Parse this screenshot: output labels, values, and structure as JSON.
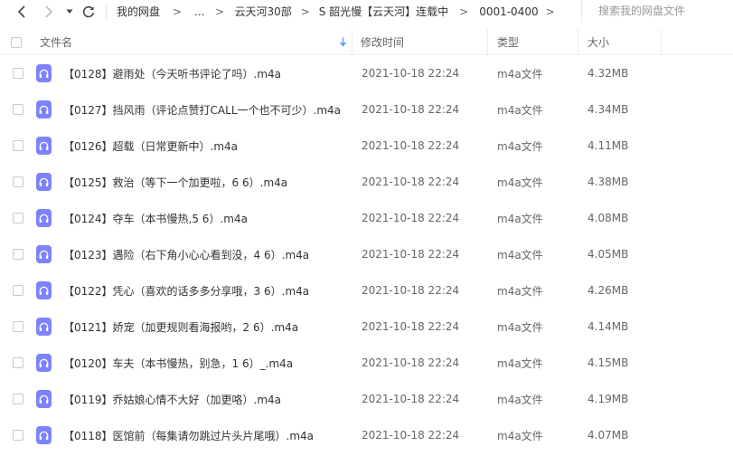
{
  "toolbar": {
    "breadcrumb": [
      "我的网盘",
      "...",
      "云天河30部",
      "S 韶光慢【云天河】连载中",
      "0001-0400"
    ],
    "breadcrumb_separator": ">",
    "search_placeholder": "搜索我的网盘文件"
  },
  "columns": {
    "name": "文件名",
    "modified": "修改时间",
    "type": "类型",
    "size": "大小",
    "sort_icon": "arrow-down-icon"
  },
  "colors": {
    "audio_icon": "#7c83fd",
    "sort_arrow": "#4a8cf7"
  },
  "files": [
    {
      "name": "【0128】避雨处（今天听书评论了吗）.m4a",
      "modified": "2021-10-18 22:24",
      "type": "m4a文件",
      "size": "4.32MB",
      "icon": "audio-file-icon"
    },
    {
      "name": "【0127】挡风雨（评论点赞打CALL一个也不可少）.m4a",
      "modified": "2021-10-18 22:24",
      "type": "m4a文件",
      "size": "4.34MB",
      "icon": "audio-file-icon"
    },
    {
      "name": "【0126】超载（日常更新中）.m4a",
      "modified": "2021-10-18 22:24",
      "type": "m4a文件",
      "size": "4.11MB",
      "icon": "audio-file-icon"
    },
    {
      "name": "【0125】救治（等下一个加更啦，6 6）.m4a",
      "modified": "2021-10-18 22:24",
      "type": "m4a文件",
      "size": "4.38MB",
      "icon": "audio-file-icon"
    },
    {
      "name": "【0124】夺车（本书慢热,5 6）.m4a",
      "modified": "2021-10-18 22:24",
      "type": "m4a文件",
      "size": "4.08MB",
      "icon": "audio-file-icon"
    },
    {
      "name": "【0123】遇险（右下角小心心看到没，4 6）.m4a",
      "modified": "2021-10-18 22:24",
      "type": "m4a文件",
      "size": "4.05MB",
      "icon": "audio-file-icon"
    },
    {
      "name": "【0122】凭心（喜欢的话多多分享哦，3 6）.m4a",
      "modified": "2021-10-18 22:24",
      "type": "m4a文件",
      "size": "4.26MB",
      "icon": "audio-file-icon"
    },
    {
      "name": "【0121】娇宠（加更规则看海报哟，2 6）.m4a",
      "modified": "2021-10-18 22:24",
      "type": "m4a文件",
      "size": "4.14MB",
      "icon": "audio-file-icon"
    },
    {
      "name": "【0120】车夫（本书慢热，别急，1 6）_.m4a",
      "modified": "2021-10-18 22:24",
      "type": "m4a文件",
      "size": "4.15MB",
      "icon": "audio-file-icon"
    },
    {
      "name": "【0119】乔姑娘心情不大好（加更咯）.m4a",
      "modified": "2021-10-18 22:24",
      "type": "m4a文件",
      "size": "4.19MB",
      "icon": "audio-file-icon"
    },
    {
      "name": "【0118】医馆前（每集请勿跳过片头片尾哦）.m4a",
      "modified": "2021-10-18 22:24",
      "type": "m4a文件",
      "size": "4.07MB",
      "icon": "audio-file-icon"
    }
  ]
}
